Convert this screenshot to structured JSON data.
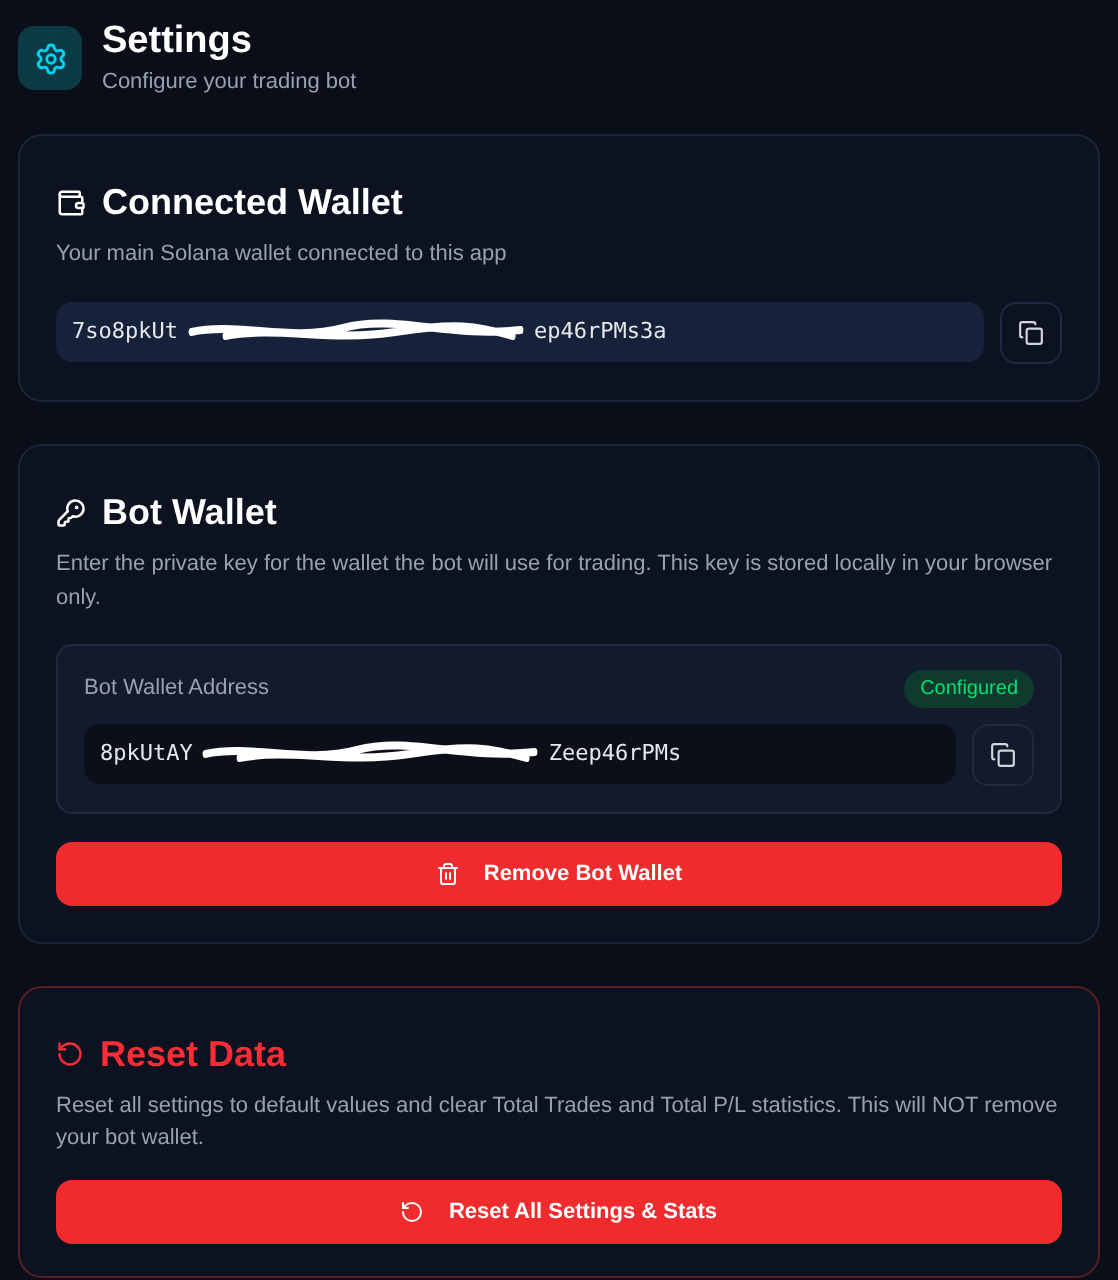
{
  "header": {
    "title": "Settings",
    "subtitle": "Configure your trading bot"
  },
  "connected_wallet": {
    "title": "Connected Wallet",
    "description": "Your main Solana wallet connected to this app",
    "address_start": "7so8pkUt",
    "address_end": "ep46rPMs3a"
  },
  "bot_wallet": {
    "title": "Bot Wallet",
    "description": "Enter the private key for the wallet the bot will use for trading. This key is stored locally in your browser only.",
    "address_label": "Bot Wallet Address",
    "status": "Configured",
    "configured": true,
    "address_start": "8pkUtAY",
    "address_end": "Zeep46rPMs",
    "remove_button": "Remove Bot Wallet"
  },
  "reset_data": {
    "title": "Reset Data",
    "description": "Reset all settings to default values and clear Total Trades and Total P/L statistics. This will NOT remove your bot wallet.",
    "button": "Reset All Settings & Stats"
  }
}
